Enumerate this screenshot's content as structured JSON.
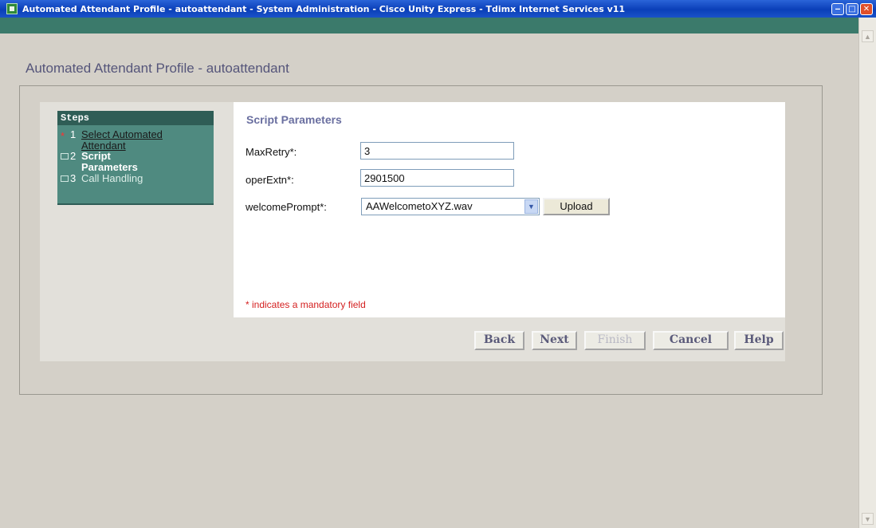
{
  "window": {
    "title": "Automated Attendant Profile - autoattendant - System Administration - Cisco Unity Express - Tdimx Internet Services v11",
    "minimize_glyph": "‒",
    "maximize_glyph": "□",
    "close_glyph": "✕"
  },
  "page": {
    "title": "Automated Attendant Profile - autoattendant"
  },
  "steps": {
    "header": "Steps",
    "items": [
      {
        "marker": "*",
        "num": "1",
        "label_line1": "Select Automated",
        "label_line2": "Attendant",
        "state": "completed"
      },
      {
        "marker": "box",
        "num": "2",
        "label_line1": "Script",
        "label_line2": "Parameters",
        "state": "current"
      },
      {
        "marker": "box",
        "num": "3",
        "label_line1": "Call Handling",
        "label_line2": "",
        "state": "pending"
      }
    ]
  },
  "form": {
    "section_title": "Script Parameters",
    "fields": {
      "max_retry": {
        "label": "MaxRetry*:",
        "value": "3"
      },
      "oper_extn": {
        "label": "operExtn*:",
        "value": "2901500"
      },
      "welcome_prompt": {
        "label": "welcomePrompt*:",
        "value": "AAWelcometoXYZ.wav"
      }
    },
    "upload_label": "Upload",
    "mandatory_note": "* indicates a mandatory field"
  },
  "buttons": {
    "back": "Back",
    "next": "Next",
    "finish": "Finish",
    "cancel": "Cancel",
    "help": "Help"
  },
  "colors": {
    "title_bar": "#0a3fb8",
    "app_band": "#3b7a6b",
    "steps_panel": "#4f8a80",
    "page_title": "#55557a",
    "mandatory_text": "#d42020"
  }
}
